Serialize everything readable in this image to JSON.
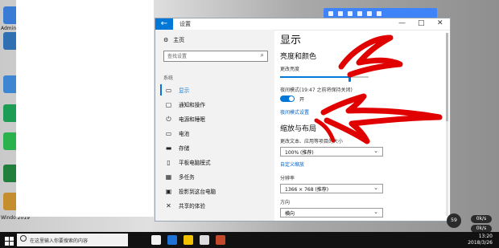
{
  "window": {
    "title": "设置",
    "controls": [
      "—",
      "□",
      "✕"
    ]
  },
  "sidebar": {
    "home_label": "主页",
    "search_placeholder": "查找设置",
    "section_label": "系统",
    "items": [
      {
        "label": "显示",
        "icon": "monitor-icon",
        "active": true
      },
      {
        "label": "通知和操作",
        "icon": "message-icon"
      },
      {
        "label": "电源和睡眠",
        "icon": "power-icon"
      },
      {
        "label": "电池",
        "icon": "battery-icon"
      },
      {
        "label": "存储",
        "icon": "storage-icon"
      },
      {
        "label": "平板电脑模式",
        "icon": "tablet-icon"
      },
      {
        "label": "多任务",
        "icon": "multitask-icon"
      },
      {
        "label": "投影到这台电脑",
        "icon": "project-icon"
      },
      {
        "label": "共享的体验",
        "icon": "share-icon"
      }
    ]
  },
  "main": {
    "heading": "显示",
    "section_brightness": "亮度和颜色",
    "brightness_label": "更改亮度",
    "brightness_value": 0.78,
    "night_light_label": "夜间模式(19:47 之前将保持关闭)",
    "night_light_toggle": "开",
    "night_light_link": "夜间模式设置",
    "section_scale": "缩放与布局",
    "scale_label": "更改文本、应用等项目的大小",
    "scale_value": "100% (推荐)",
    "custom_scale_link": "自定义缩放",
    "resolution_label": "分辨率",
    "resolution_value": "1366 × 768 (推荐)",
    "orientation_label": "方向",
    "orientation_value": "横向"
  },
  "taskbar": {
    "search_text": "在这里输入你要搜索的内容",
    "time": "13:20",
    "date": "2018/3/26"
  },
  "desktop": {
    "labels": [
      "Adminis",
      "Windo 2019"
    ],
    "badge": "59",
    "pill_top": "0k/s",
    "pill_bottom": "0k/s"
  },
  "colors": {
    "accent": "#0078d7",
    "annotation": "#e10000"
  }
}
